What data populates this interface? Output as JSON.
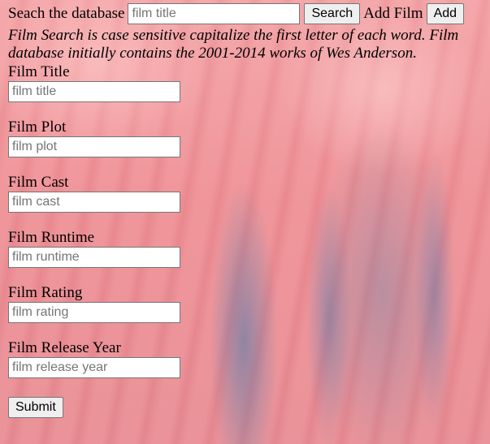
{
  "header": {
    "search_label": "Seach the database",
    "search_placeholder": "film title",
    "search_button": "Search",
    "add_label": "Add Film",
    "add_button": "Add"
  },
  "note": "Film Search is case sensitive capitalize the first letter of each word. Film database initially contains the 2001-2014 works of Wes Anderson.",
  "form": {
    "fields": [
      {
        "label": "Film Title",
        "placeholder": "film title"
      },
      {
        "label": "Film Plot",
        "placeholder": "film plot"
      },
      {
        "label": "Film Cast",
        "placeholder": "film cast"
      },
      {
        "label": "Film Runtime",
        "placeholder": "film runtime"
      },
      {
        "label": "Film Rating",
        "placeholder": "film rating"
      },
      {
        "label": "Film Release Year",
        "placeholder": "film release year"
      }
    ],
    "submit_label": "Submit"
  }
}
